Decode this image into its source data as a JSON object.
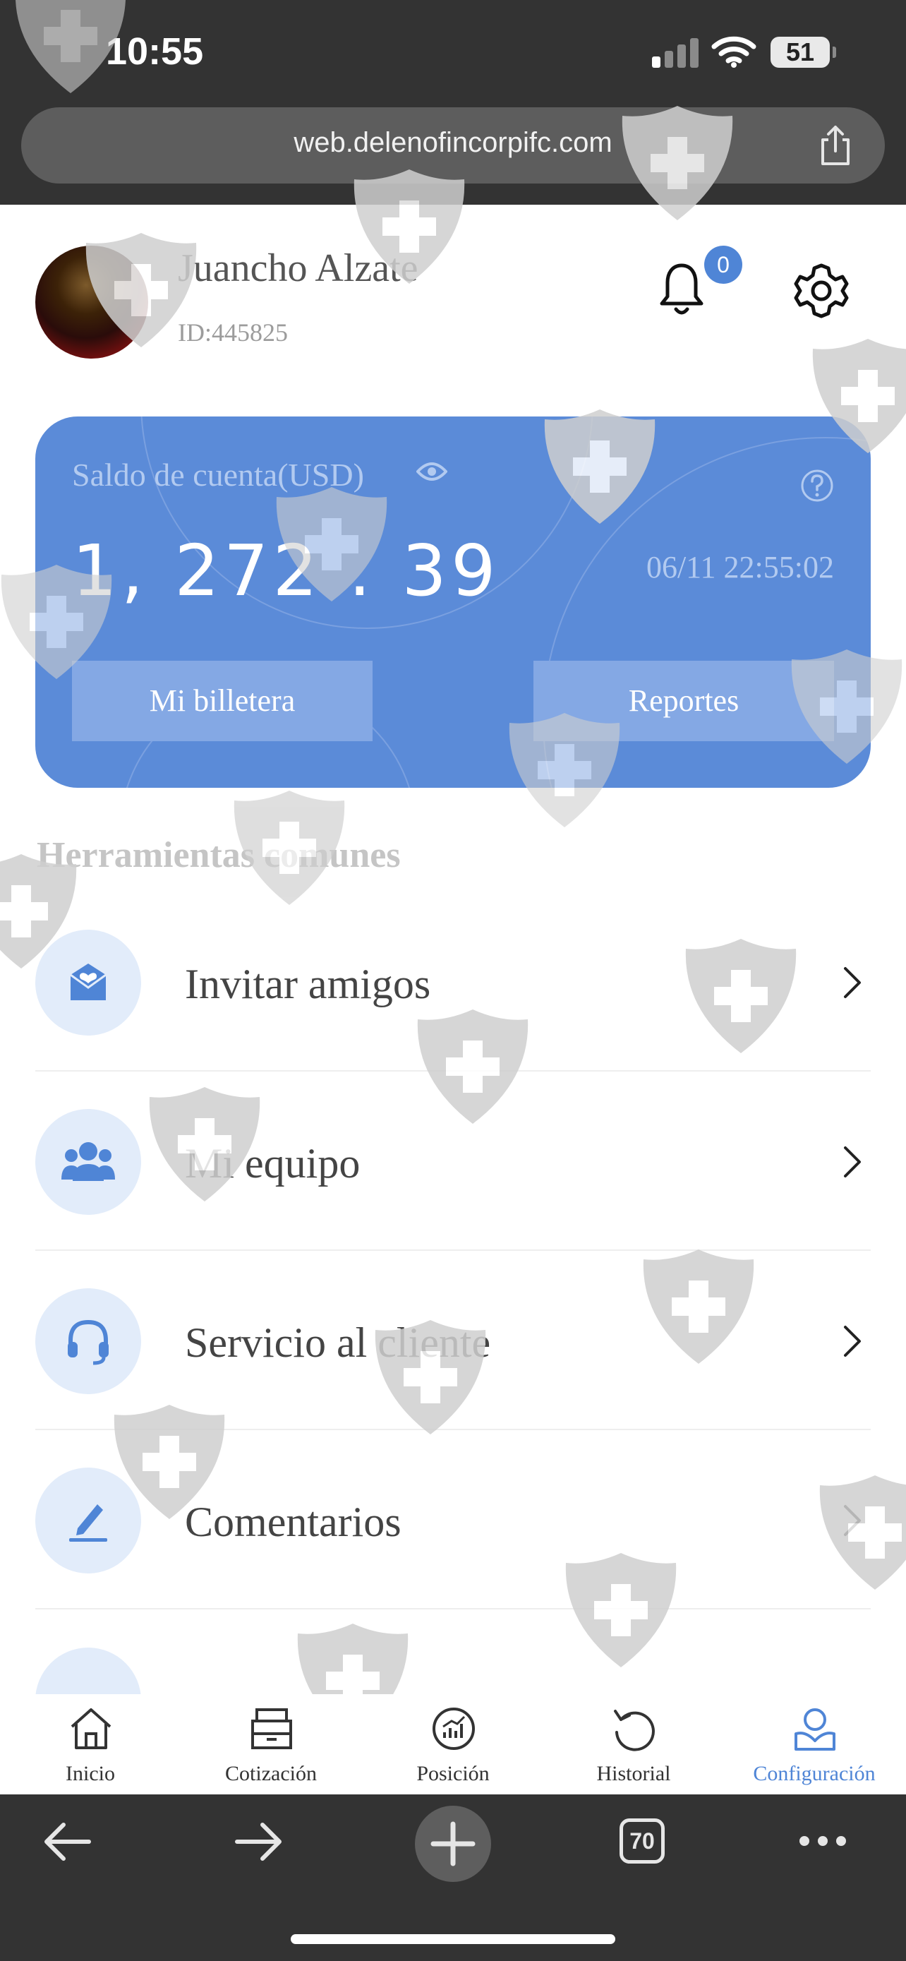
{
  "status_bar": {
    "time": "10:55",
    "battery": "51"
  },
  "browser": {
    "url": "web.delenofincorpifc.com",
    "tab_count": "70"
  },
  "profile": {
    "name": "Juancho Alzate",
    "id": "ID:445825",
    "notification_count": "0"
  },
  "balance_card": {
    "label": "Saldo de cuenta(USD)",
    "amount": "1, 272 . 39",
    "timestamp": "06/11 22:55:02",
    "wallet_button": "Mi billetera",
    "reports_button": "Reportes"
  },
  "tools": {
    "title": "Herramientas comunes",
    "items": [
      {
        "label": "Invitar amigos",
        "icon": "envelope-heart-icon"
      },
      {
        "label": "Mi equipo",
        "icon": "team-icon"
      },
      {
        "label": "Servicio al cliente",
        "icon": "headset-icon"
      },
      {
        "label": "Comentarios",
        "icon": "edit-icon"
      }
    ]
  },
  "tabbar": {
    "items": [
      {
        "label": "Inicio",
        "icon": "home-icon"
      },
      {
        "label": "Cotización",
        "icon": "archive-icon"
      },
      {
        "label": "Posición",
        "icon": "chart-icon"
      },
      {
        "label": "Historial",
        "icon": "history-icon"
      },
      {
        "label": "Configuración",
        "icon": "user-icon"
      }
    ],
    "active_index": 4
  },
  "colors": {
    "accent": "#4f85d6",
    "card": "#5b8bd8",
    "chrome": "#333333"
  }
}
